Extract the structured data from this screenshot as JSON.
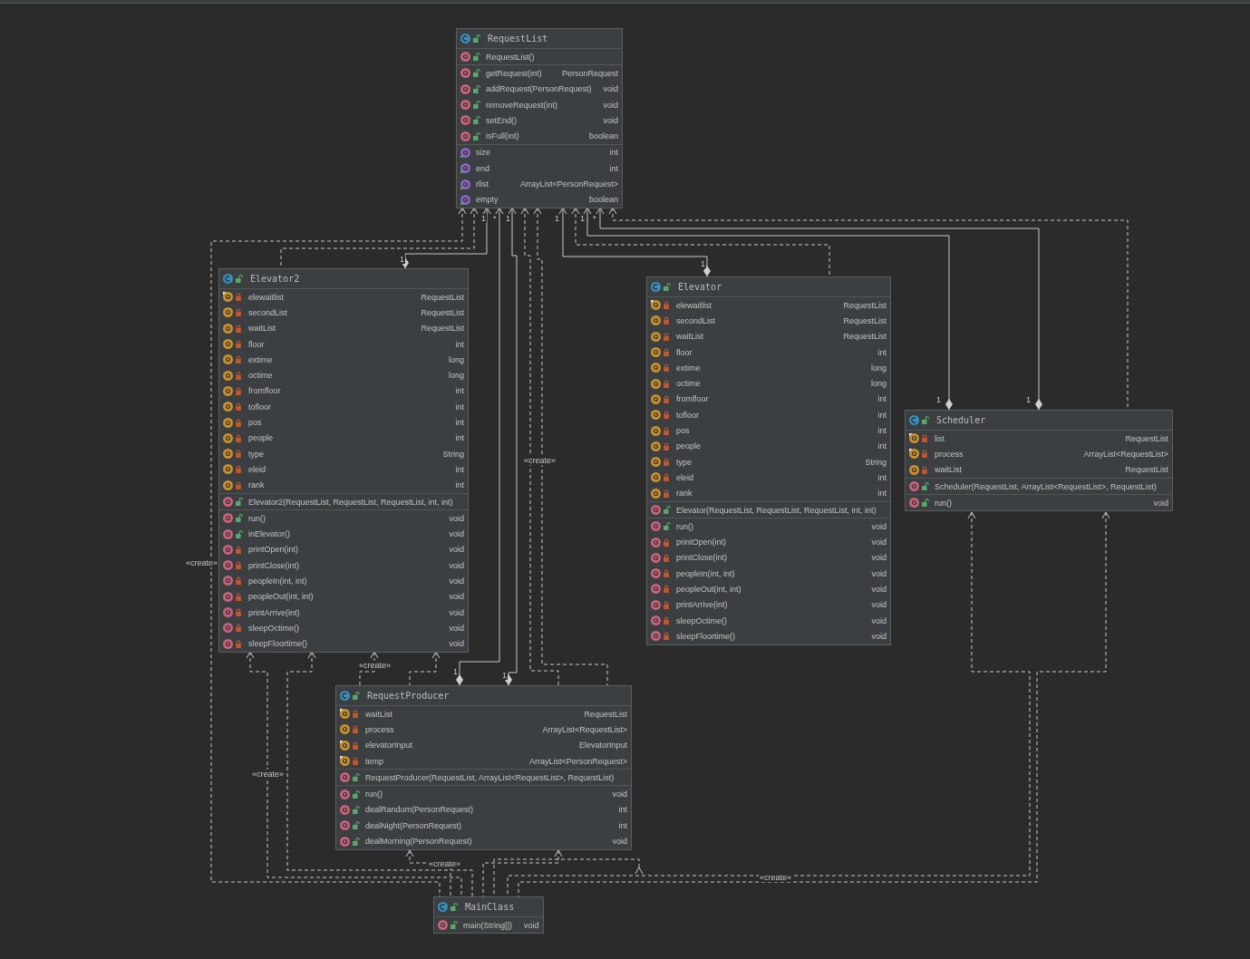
{
  "classes": [
    {
      "name": "RequestList",
      "sections": [
        [
          {
            "kind": "method",
            "private": false,
            "final": false,
            "name": "RequestList()"
          }
        ],
        [
          {
            "kind": "method",
            "private": false,
            "final": false,
            "name": "getRequest(int)",
            "type": "PersonRequest"
          },
          {
            "kind": "method",
            "private": false,
            "final": false,
            "name": "addRequest(PersonRequest)",
            "type": "void"
          },
          {
            "kind": "method",
            "private": false,
            "final": false,
            "name": "removeRequest(int)",
            "type": "void"
          },
          {
            "kind": "method",
            "private": false,
            "final": false,
            "name": "setEnd()",
            "type": "void"
          },
          {
            "kind": "method",
            "private": false,
            "final": false,
            "name": "isFull(int)",
            "type": "boolean"
          }
        ],
        [
          {
            "kind": "property",
            "final": false,
            "name": "size",
            "type": "int"
          },
          {
            "kind": "property",
            "final": false,
            "name": "end",
            "type": "int"
          },
          {
            "kind": "property",
            "final": false,
            "name": "rlist",
            "type": "ArrayList<PersonRequest>"
          },
          {
            "kind": "property",
            "final": false,
            "name": "empty",
            "type": "boolean"
          }
        ]
      ]
    },
    {
      "name": "Elevator2",
      "sections": [
        [
          {
            "kind": "field",
            "private": true,
            "final": true,
            "name": "elewaitlist",
            "type": "RequestList"
          },
          {
            "kind": "field",
            "private": true,
            "final": false,
            "name": "secondList",
            "type": "RequestList"
          },
          {
            "kind": "field",
            "private": true,
            "final": false,
            "name": "waitList",
            "type": "RequestList"
          },
          {
            "kind": "field",
            "private": true,
            "final": false,
            "name": "floor",
            "type": "int"
          },
          {
            "kind": "field",
            "private": true,
            "final": false,
            "name": "extime",
            "type": "long"
          },
          {
            "kind": "field",
            "private": true,
            "final": false,
            "name": "octime",
            "type": "long"
          },
          {
            "kind": "field",
            "private": true,
            "final": false,
            "name": "fromfloor",
            "type": "int"
          },
          {
            "kind": "field",
            "private": true,
            "final": false,
            "name": "tofloor",
            "type": "int"
          },
          {
            "kind": "field",
            "private": true,
            "final": false,
            "name": "pos",
            "type": "int"
          },
          {
            "kind": "field",
            "private": true,
            "final": false,
            "name": "people",
            "type": "int"
          },
          {
            "kind": "field",
            "private": true,
            "final": false,
            "name": "type",
            "type": "String"
          },
          {
            "kind": "field",
            "private": true,
            "final": false,
            "name": "eleid",
            "type": "int"
          },
          {
            "kind": "field",
            "private": true,
            "final": false,
            "name": "rank",
            "type": "int"
          }
        ],
        [
          {
            "kind": "method",
            "private": false,
            "final": false,
            "name": "Elevator2(RequestList, RequestList, RequestList, int, int)"
          }
        ],
        [
          {
            "kind": "method",
            "private": false,
            "final": false,
            "name": "run()",
            "type": "void"
          },
          {
            "kind": "method",
            "private": false,
            "final": false,
            "name": "inElevator()",
            "type": "void"
          },
          {
            "kind": "method",
            "private": true,
            "final": false,
            "name": "printOpen(int)",
            "type": "void"
          },
          {
            "kind": "method",
            "private": true,
            "final": false,
            "name": "printClose(int)",
            "type": "void"
          },
          {
            "kind": "method",
            "private": true,
            "final": false,
            "name": "peopleIn(int, int)",
            "type": "void"
          },
          {
            "kind": "method",
            "private": true,
            "final": false,
            "name": "peopleOut(int, int)",
            "type": "void"
          },
          {
            "kind": "method",
            "private": true,
            "final": false,
            "name": "printArrive(int)",
            "type": "void"
          },
          {
            "kind": "method",
            "private": true,
            "final": false,
            "name": "sleepOctime()",
            "type": "void"
          },
          {
            "kind": "method",
            "private": true,
            "final": false,
            "name": "sleepFloortime()",
            "type": "void"
          }
        ]
      ]
    },
    {
      "name": "Elevator",
      "sections": [
        [
          {
            "kind": "field",
            "private": true,
            "final": true,
            "name": "elewaitlist",
            "type": "RequestList"
          },
          {
            "kind": "field",
            "private": true,
            "final": false,
            "name": "secondList",
            "type": "RequestList"
          },
          {
            "kind": "field",
            "private": true,
            "final": false,
            "name": "waitList",
            "type": "RequestList"
          },
          {
            "kind": "field",
            "private": true,
            "final": false,
            "name": "floor",
            "type": "int"
          },
          {
            "kind": "field",
            "private": true,
            "final": false,
            "name": "extime",
            "type": "long"
          },
          {
            "kind": "field",
            "private": true,
            "final": false,
            "name": "octime",
            "type": "long"
          },
          {
            "kind": "field",
            "private": true,
            "final": false,
            "name": "fromfloor",
            "type": "int"
          },
          {
            "kind": "field",
            "private": true,
            "final": false,
            "name": "tofloor",
            "type": "int"
          },
          {
            "kind": "field",
            "private": true,
            "final": false,
            "name": "pos",
            "type": "int"
          },
          {
            "kind": "field",
            "private": true,
            "final": false,
            "name": "people",
            "type": "int"
          },
          {
            "kind": "field",
            "private": true,
            "final": false,
            "name": "type",
            "type": "String"
          },
          {
            "kind": "field",
            "private": true,
            "final": false,
            "name": "eleid",
            "type": "int"
          },
          {
            "kind": "field",
            "private": true,
            "final": false,
            "name": "rank",
            "type": "int"
          }
        ],
        [
          {
            "kind": "method",
            "private": false,
            "final": false,
            "name": "Elevator(RequestList, RequestList, RequestList, int, int)"
          }
        ],
        [
          {
            "kind": "method",
            "private": false,
            "final": false,
            "name": "run()",
            "type": "void"
          },
          {
            "kind": "method",
            "private": true,
            "final": false,
            "name": "printOpen(int)",
            "type": "void"
          },
          {
            "kind": "method",
            "private": true,
            "final": false,
            "name": "printClose(int)",
            "type": "void"
          },
          {
            "kind": "method",
            "private": true,
            "final": false,
            "name": "peopleIn(int, int)",
            "type": "void"
          },
          {
            "kind": "method",
            "private": true,
            "final": false,
            "name": "peopleOut(int, int)",
            "type": "void"
          },
          {
            "kind": "method",
            "private": true,
            "final": false,
            "name": "printArrive(int)",
            "type": "void"
          },
          {
            "kind": "method",
            "private": true,
            "final": false,
            "name": "sleepOctime()",
            "type": "void"
          },
          {
            "kind": "method",
            "private": true,
            "final": false,
            "name": "sleepFloortime()",
            "type": "void"
          }
        ]
      ]
    },
    {
      "name": "Scheduler",
      "sections": [
        [
          {
            "kind": "field",
            "private": true,
            "final": true,
            "name": "list",
            "type": "RequestList"
          },
          {
            "kind": "field",
            "private": true,
            "final": true,
            "name": "process",
            "type": "ArrayList<RequestList>"
          },
          {
            "kind": "field",
            "private": true,
            "final": false,
            "name": "waitList",
            "type": "RequestList"
          }
        ],
        [
          {
            "kind": "method",
            "private": false,
            "final": false,
            "name": "Scheduler(RequestList, ArrayList<RequestList>, RequestList)"
          }
        ],
        [
          {
            "kind": "method",
            "private": false,
            "final": false,
            "name": "run()",
            "type": "void"
          }
        ]
      ]
    },
    {
      "name": "RequestProducer",
      "sections": [
        [
          {
            "kind": "field",
            "private": true,
            "final": true,
            "name": "waitList",
            "type": "RequestList"
          },
          {
            "kind": "field",
            "private": true,
            "final": false,
            "name": "process",
            "type": "ArrayList<RequestList>"
          },
          {
            "kind": "field",
            "private": true,
            "final": true,
            "name": "elevatorInput",
            "type": "ElevatorInput"
          },
          {
            "kind": "field",
            "private": true,
            "final": true,
            "name": "temp",
            "type": "ArrayList<PersonRequest>"
          }
        ],
        [
          {
            "kind": "method",
            "private": false,
            "final": false,
            "name": "RequestProducer(RequestList, ArrayList<RequestList>, RequestList)"
          }
        ],
        [
          {
            "kind": "method",
            "private": false,
            "final": false,
            "name": "run()",
            "type": "void"
          },
          {
            "kind": "method",
            "private": false,
            "final": false,
            "name": "dealRandom(PersonRequest)",
            "type": "int"
          },
          {
            "kind": "method",
            "private": false,
            "final": false,
            "name": "dealNight(PersonRequest)",
            "type": "int"
          },
          {
            "kind": "method",
            "private": false,
            "final": false,
            "name": "dealMorning(PersonRequest)",
            "type": "void"
          }
        ]
      ]
    },
    {
      "name": "MainClass",
      "sections": [
        [
          {
            "kind": "method",
            "private": false,
            "final": false,
            "name": "main(String[])",
            "type": "void"
          }
        ]
      ]
    }
  ],
  "edge_labels": [
    "1",
    "*",
    "1",
    "1",
    "1",
    "*",
    "1",
    "1",
    "1",
    "1",
    "1",
    "1",
    "«create»",
    "«create»",
    "«create»",
    "«create»",
    "«create»",
    "«create»"
  ]
}
